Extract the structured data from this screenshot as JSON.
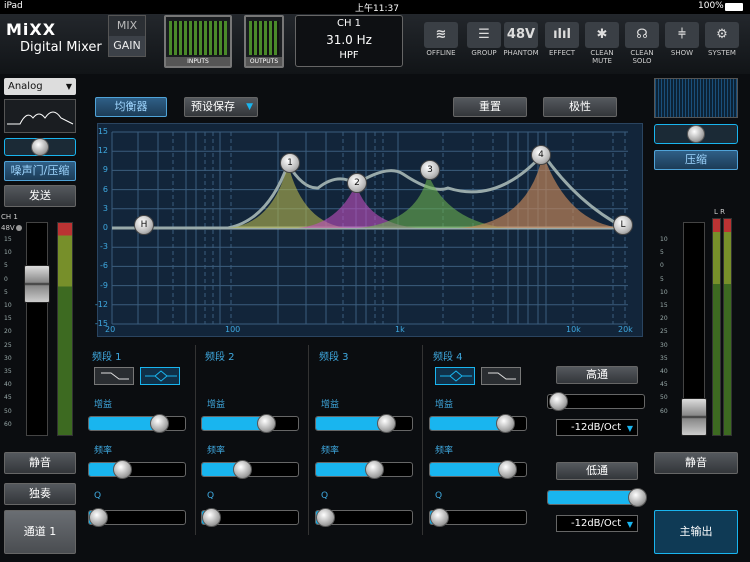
{
  "status": {
    "device": "iPad",
    "time": "上午11:37",
    "battery": "100%"
  },
  "header": {
    "logo": "MiXX",
    "logo_sub": "Digital Mixer",
    "mix": "MIX",
    "gain": "GAIN",
    "inputs": "INPUTS",
    "outputs": "OUTPUTS",
    "channel": "CH 1",
    "freq": "31.0 Hz",
    "filter": "HPF",
    "buttons": [
      {
        "label": "OFFLINE",
        "icon": "wifi-icon",
        "glyph": "≋"
      },
      {
        "label": "GROUP",
        "icon": "group-icon",
        "glyph": "☰"
      },
      {
        "label": "PHANTOM",
        "icon": "phantom-icon",
        "glyph": "48V"
      },
      {
        "label": "EFFECT",
        "icon": "effect-icon",
        "glyph": "ılıl"
      },
      {
        "label": "CLEAN MUTE",
        "icon": "clean-mute-icon",
        "glyph": "✱"
      },
      {
        "label": "CLEAN SOLO",
        "icon": "clean-solo-icon",
        "glyph": "☊"
      },
      {
        "label": "SHOW",
        "icon": "show-icon",
        "glyph": "⫩"
      },
      {
        "label": "SYSTEM",
        "icon": "gear-icon",
        "glyph": "⚙"
      }
    ]
  },
  "left": {
    "analog": "Analog",
    "noise_gate": "噪声门/压缩",
    "send": "发送",
    "ch_label": "CH 1",
    "phantom": "48V",
    "scale": [
      "15",
      "10",
      "5",
      "0",
      "5",
      "10",
      "15",
      "20",
      "25",
      "30",
      "35",
      "40",
      "45",
      "50",
      "60"
    ],
    "mute": "静音",
    "solo": "独奏",
    "channel_btn": "通道 1"
  },
  "eq": {
    "equalizer": "均衡器",
    "preset": "预设保存",
    "reset": "重置",
    "polarity": "极性",
    "yticks": [
      "15",
      "12",
      "9",
      "6",
      "3",
      "0",
      "-3",
      "-6",
      "-9",
      "-12",
      "-15"
    ],
    "xticks": [
      "20",
      "100",
      "1k",
      "10k",
      "20k"
    ],
    "nodes": [
      "H",
      "1",
      "2",
      "3",
      "4",
      "L"
    ]
  },
  "bands": [
    {
      "name": "频段 1",
      "gain": "增益",
      "freq": "频率",
      "q": "Q",
      "gain_v": 0.72,
      "freq_v": 0.35,
      "q_v": 0.1
    },
    {
      "name": "频段 2",
      "gain": "增益",
      "freq": "频率",
      "q": "Q",
      "gain_v": 0.66,
      "freq_v": 0.42,
      "q_v": 0.1
    },
    {
      "name": "频段 3",
      "gain": "增益",
      "freq": "频率",
      "q": "Q",
      "gain_v": 0.72,
      "freq_v": 0.6,
      "q_v": 0.1
    },
    {
      "name": "频段 4",
      "gain": "增益",
      "freq": "频率",
      "q": "Q",
      "gain_v": 0.78,
      "freq_v": 0.8,
      "q_v": 0.1
    }
  ],
  "filters": {
    "highpass": "高通",
    "hp_slope": "-12dB/Oct",
    "lowpass": "低通",
    "lp_slope": "-12dB/Oct",
    "hp_v": 0.05,
    "lp_v": 0.92
  },
  "right": {
    "compress": "压缩",
    "lr": "L R",
    "scale": [
      "10",
      "5",
      "0",
      "5",
      "10",
      "15",
      "20",
      "25",
      "30",
      "35",
      "40",
      "45",
      "50",
      "60"
    ],
    "mute": "静音",
    "main_out": "主输出"
  }
}
